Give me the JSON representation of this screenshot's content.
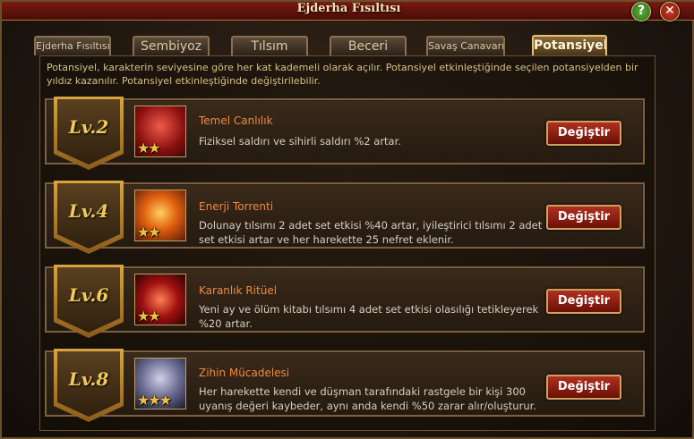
{
  "window": {
    "title": "Ejderha Fısıltısı",
    "help_label": "?",
    "close_label": "✕"
  },
  "tabs": [
    {
      "label": "Ejderha Fısıltısı",
      "active": false
    },
    {
      "label": "Sembiyoz",
      "active": false
    },
    {
      "label": "Tılsım",
      "active": false
    },
    {
      "label": "Beceri",
      "active": false
    },
    {
      "label": "Savaş Canavarı",
      "active": false
    },
    {
      "label": "Potansiyel",
      "active": true
    }
  ],
  "description": "Potansiyel, karakterin seviyesine göre her kat kademeli olarak açılır. Potansiyel etkinleştiğinde seçilen potansiyelden bir yıldız kazanılır. Potansiyel etkinleştiğinde değiştirilebilir.",
  "potentials": [
    {
      "level": "Lv.2",
      "icon": "red-crystal-icon",
      "stars": "★★",
      "name": "Temel Canlılık",
      "description": "Fiziksel saldırı ve sihirli saldırı %2 artar.",
      "button_label": "Değiştir"
    },
    {
      "level": "Lv.4",
      "icon": "fire-dragon-icon",
      "stars": "★★",
      "name": "Enerji Torrenti",
      "description": "Dolunay tılsımı 2 adet set etkisi %40 artar, iyileştirici tılsımı 2 adet set etkisi artar ve her harekette 25 nefret eklenir.",
      "button_label": "Değiştir"
    },
    {
      "level": "Lv.6",
      "icon": "dark-flame-icon",
      "stars": "★★",
      "name": "Karanlık Ritüel",
      "description": "Yeni ay ve ölüm kitabı tılsımı 4 adet set etkisi olasılığı tetikleyerek %20 artar.",
      "button_label": "Değiştir"
    },
    {
      "level": "Lv.8",
      "icon": "tornado-icon",
      "stars": "★★★",
      "name": "Zihin Mücadelesi",
      "description": "Her harekette kendi ve düşman tarafındaki rastgele bir kişi 300 uyanış değeri kaybeder, aynı anda kendi %50 zarar alır/oluşturur.",
      "button_label": "Değiştir"
    }
  ],
  "colors": {
    "accent": "#f2c85a",
    "skill_name": "#f08a40",
    "button": "#b03020"
  }
}
